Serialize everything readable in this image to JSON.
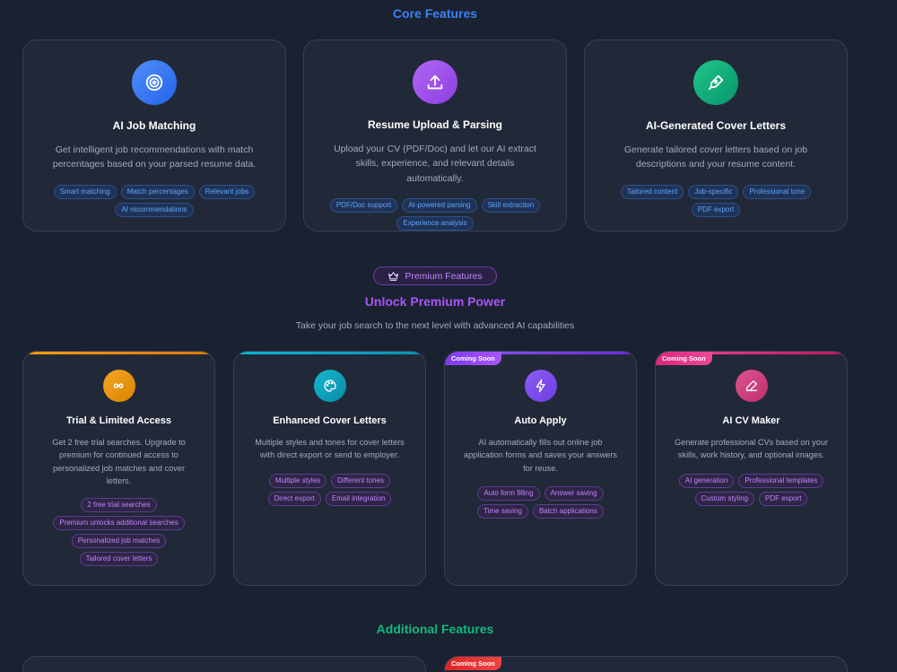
{
  "sections": {
    "core_title": "Core Features",
    "premium_pill": "Premium Features",
    "premium_title": "Unlock Premium Power",
    "premium_subtitle": "Take your job search to the next level with advanced AI capabilities",
    "additional_title": "Additional Features"
  },
  "core_cards": [
    {
      "title": "AI Job Matching",
      "desc": "Get intelligent job recommendations with match percentages based on your parsed resume data.",
      "icon": "target-icon",
      "color": "#3b82f6",
      "tags": [
        "Smart matching",
        "Match percentages",
        "Relevant jobs",
        "AI recommendations"
      ]
    },
    {
      "title": "Resume Upload & Parsing",
      "desc": "Upload your CV (PDF/Doc) and let our AI extract skills, experience, and relevant details automatically.",
      "icon": "upload-icon",
      "color": "#a855f7",
      "tags": [
        "PDF/Doc support",
        "AI-powered parsing",
        "Skill extraction",
        "Experience analysis"
      ]
    },
    {
      "title": "AI-Generated Cover Letters",
      "desc": "Generate tailored cover letters based on job descriptions and your resume content.",
      "icon": "pen-icon",
      "color": "#10b981",
      "tags": [
        "Tailored content",
        "Job-specific",
        "Professional tone",
        "PDF export"
      ]
    }
  ],
  "premium_cards": [
    {
      "title": "Trial & Limited Access",
      "desc": "Get 2 free trial searches. Upgrade to premium for continued access to personalized job matches and cover letters.",
      "icon": "infinity-icon",
      "color": "#f59e0b",
      "tags": [
        "2 free trial searches",
        "Premium unlocks additional searches",
        "Personalized job matches",
        "Tailored cover letters"
      ]
    },
    {
      "title": "Enhanced Cover Letters",
      "desc": "Multiple styles and tones for cover letters with direct export or send to employer.",
      "icon": "palette-icon",
      "color": "#06b6d4",
      "tags": [
        "Multiple styles",
        "Different tones",
        "Direct export",
        "Email integration"
      ]
    },
    {
      "title": "Auto Apply",
      "desc": "AI automatically fills out online job application forms and saves your answers for reuse.",
      "icon": "lightning-icon",
      "color": "#8b5cf6",
      "badge": "Coming Soon",
      "tags": [
        "Auto form filling",
        "Answer saving",
        "Time saving",
        "Batch applications"
      ]
    },
    {
      "title": "AI CV Maker",
      "desc": "Generate professional CVs based on your skills, work history, and optional images.",
      "icon": "pencil-icon",
      "color": "#ec4899",
      "badge": "Coming Soon",
      "tags": [
        "AI generation",
        "Professional templates",
        "Custom styling",
        "PDF export"
      ]
    }
  ],
  "additional_badge": "Coming Soon"
}
